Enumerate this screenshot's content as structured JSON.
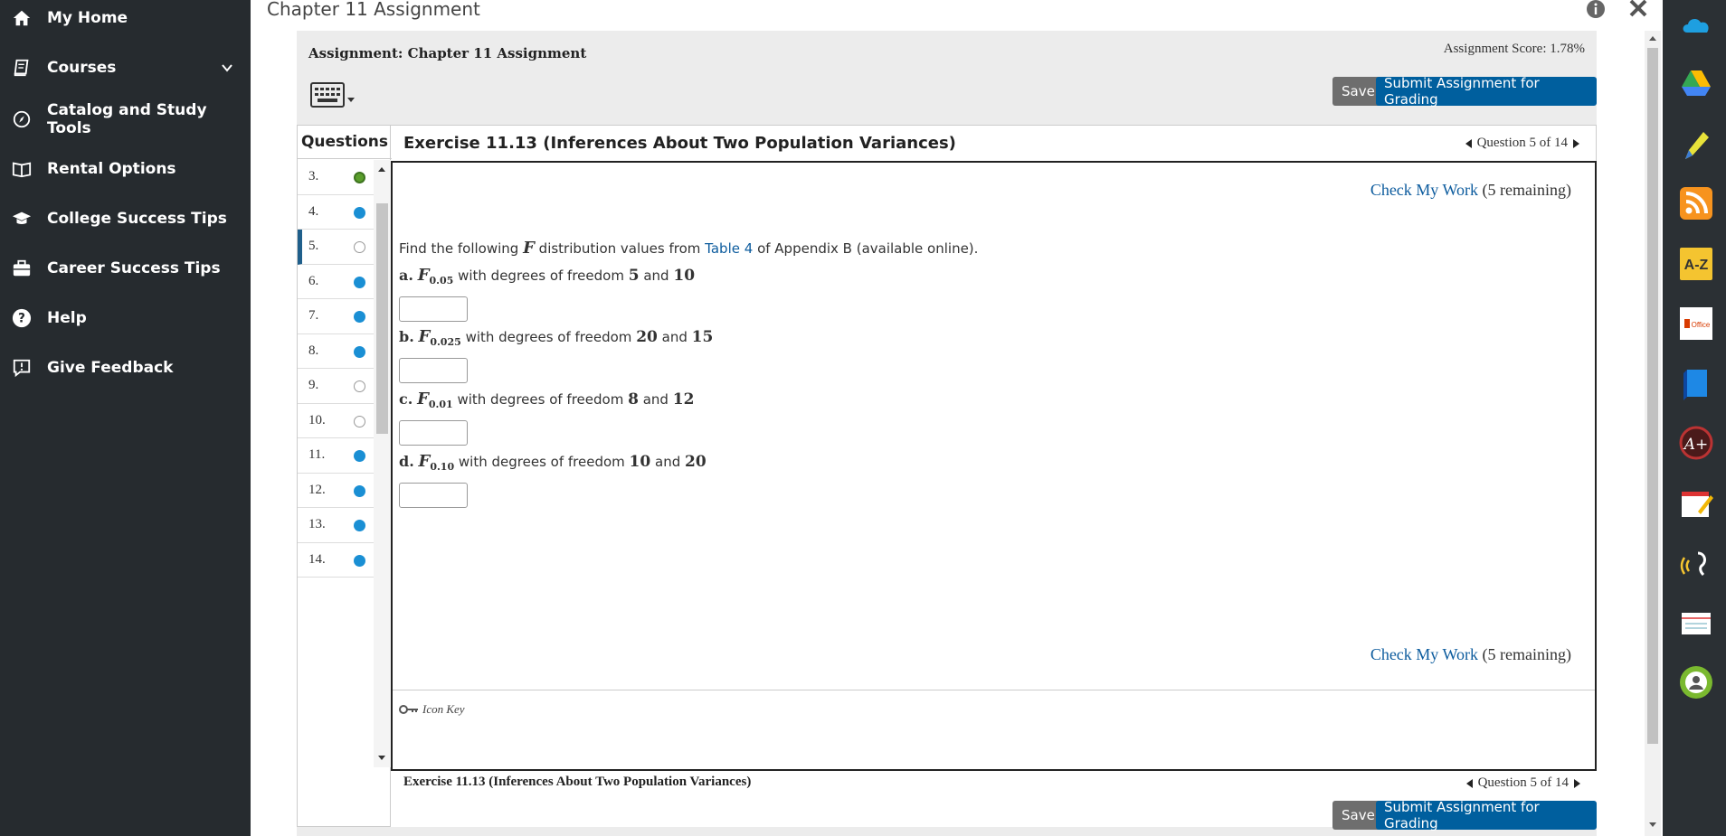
{
  "sidebar": {
    "items": [
      {
        "label": "My Home",
        "icon": "home-icon"
      },
      {
        "label": "Courses",
        "icon": "book-icon"
      },
      {
        "label": "Catalog and Study Tools",
        "icon": "compass-icon"
      },
      {
        "label": "Rental Options",
        "icon": "open-book-icon"
      },
      {
        "label": "College Success Tips",
        "icon": "graduation-cap-icon"
      },
      {
        "label": "Career Success Tips",
        "icon": "briefcase-icon"
      },
      {
        "label": "Help",
        "icon": "question-icon"
      },
      {
        "label": "Give Feedback",
        "icon": "feedback-icon"
      }
    ]
  },
  "window": {
    "title": "Chapter 11 Assignment"
  },
  "assignment": {
    "title": "Assignment: Chapter 11 Assignment",
    "score": "Assignment Score: 1.78%",
    "save_label": "Save",
    "submit_label": "Submit Assignment for Grading"
  },
  "questions": {
    "header": "Questions",
    "items": [
      {
        "num": "3.",
        "status": "partial"
      },
      {
        "num": "4.",
        "status": "answered"
      },
      {
        "num": "5.",
        "status": "empty",
        "active": true
      },
      {
        "num": "6.",
        "status": "answered"
      },
      {
        "num": "7.",
        "status": "answered"
      },
      {
        "num": "8.",
        "status": "answered"
      },
      {
        "num": "9.",
        "status": "empty"
      },
      {
        "num": "10.",
        "status": "empty"
      },
      {
        "num": "11.",
        "status": "answered"
      },
      {
        "num": "12.",
        "status": "answered"
      },
      {
        "num": "13.",
        "status": "answered"
      },
      {
        "num": "14.",
        "status": "answered"
      }
    ]
  },
  "exercise": {
    "title": "Exercise 11.13 (Inferences About Two Population Variances)",
    "question_nav": "Question 5 of 14",
    "check_link": "Check My Work",
    "check_remaining": "(5 remaining)",
    "instr_pre": "Find the following",
    "instr_var": "F",
    "instr_mid": "distribution values from",
    "instr_link": "Table 4",
    "instr_post": "of Appendix B (available online).",
    "parts": [
      {
        "letter": "a.",
        "sub": "0.05",
        "text": "with degrees of freedom",
        "df1": "5",
        "and": "and",
        "df2": "10"
      },
      {
        "letter": "b.",
        "sub": "0.025",
        "text": "with degrees of freedom",
        "df1": "20",
        "and": "and",
        "df2": "15"
      },
      {
        "letter": "c.",
        "sub": "0.01",
        "text": "with degrees of freedom",
        "df1": "8",
        "and": "and",
        "df2": "12"
      },
      {
        "letter": "d.",
        "sub": "0.10",
        "text": "with degrees of freedom",
        "df1": "10",
        "and": "and",
        "df2": "20"
      }
    ],
    "icon_key": "Icon Key"
  },
  "colors": {
    "sidebar_bg": "#262b2f",
    "accent": "#005f9e",
    "answered_dot": "#1a8fd4",
    "partial_dot": "#5a9e2b"
  },
  "dock": [
    "cloud-icon",
    "drive-icon",
    "highlighter-icon",
    "rss-icon",
    "a-z-icon",
    "office-icon",
    "ebook-icon",
    "aplus-icon",
    "notes-icon",
    "audio-icon",
    "flashcards-icon",
    "profile-icon"
  ]
}
